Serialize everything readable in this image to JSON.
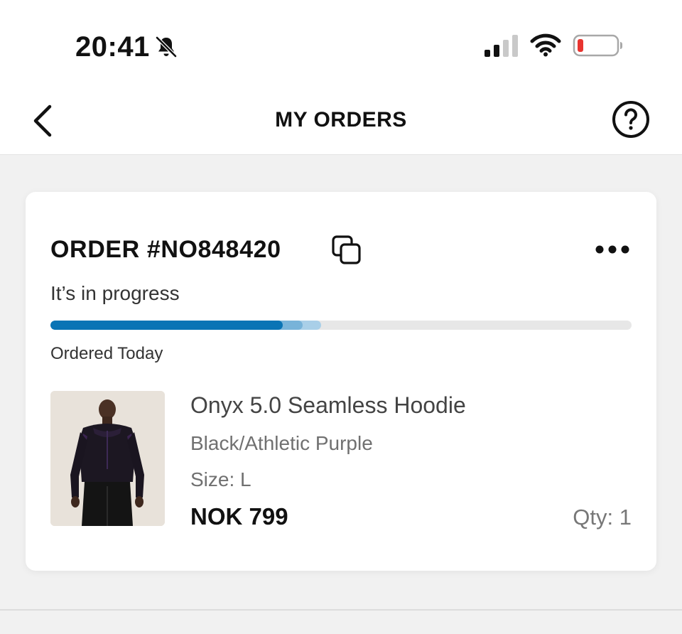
{
  "status_bar": {
    "time": "20:41",
    "icons": [
      "bell-muted-icon",
      "cellular-signal-icon",
      "wifi-icon",
      "battery-low-icon"
    ],
    "battery_color": "#e8342f"
  },
  "nav": {
    "title": "MY ORDERS",
    "back_icon": "chevron-left-icon",
    "help_icon": "question-circle-icon"
  },
  "order": {
    "number": "ORDER #NO848420",
    "status": "It’s in progress",
    "progress_percent": 40,
    "progress_colors": {
      "filled": "#0a74b5",
      "partial": "#78b3d9",
      "light": "#a9cfe8",
      "track": "#e7e7e7"
    },
    "ordered_label": "Ordered Today",
    "item": {
      "name": "Onyx 5.0 Seamless Hoodie",
      "color": "Black/Athletic Purple",
      "size": "Size: L",
      "price": "NOK 799",
      "quantity": "Qty: 1"
    }
  }
}
